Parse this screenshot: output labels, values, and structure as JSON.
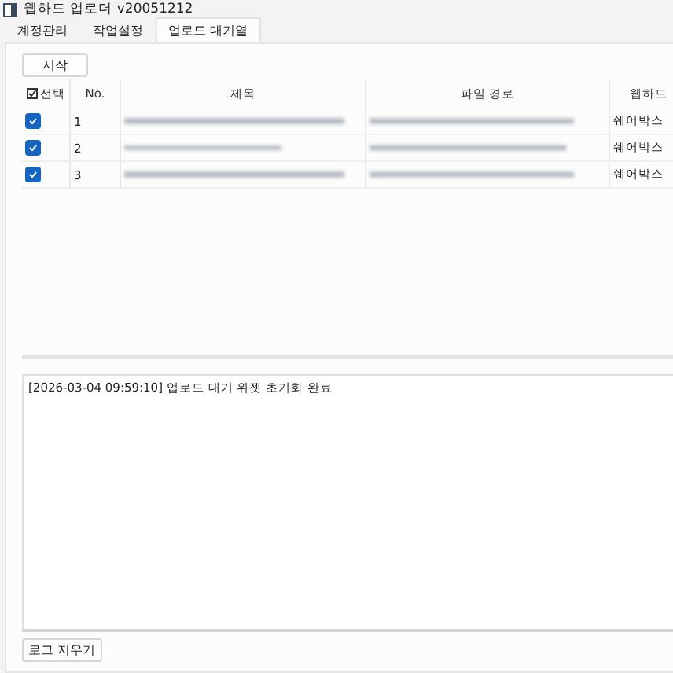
{
  "window": {
    "title": "웹하드 업로더 v20051212"
  },
  "tabs": [
    {
      "label": "계정관리",
      "selected": false
    },
    {
      "label": "작업설정",
      "selected": false
    },
    {
      "label": "업로드 대기열",
      "selected": true
    }
  ],
  "start_button": "시작",
  "table": {
    "columns": [
      "선택",
      "No.",
      "제목",
      "파일 경로",
      "웹하드"
    ],
    "rows": [
      {
        "checked": true,
        "no": "1",
        "webhard": "쉐어박스"
      },
      {
        "checked": true,
        "no": "2",
        "webhard": "쉐어박스"
      },
      {
        "checked": true,
        "no": "3",
        "webhard": "쉐어박스"
      }
    ]
  },
  "log": [
    "[2026-03-04 09:59:10] 업로드 대기 위젯 초기화 완료"
  ],
  "clear_log_button": "로그 지우기"
}
